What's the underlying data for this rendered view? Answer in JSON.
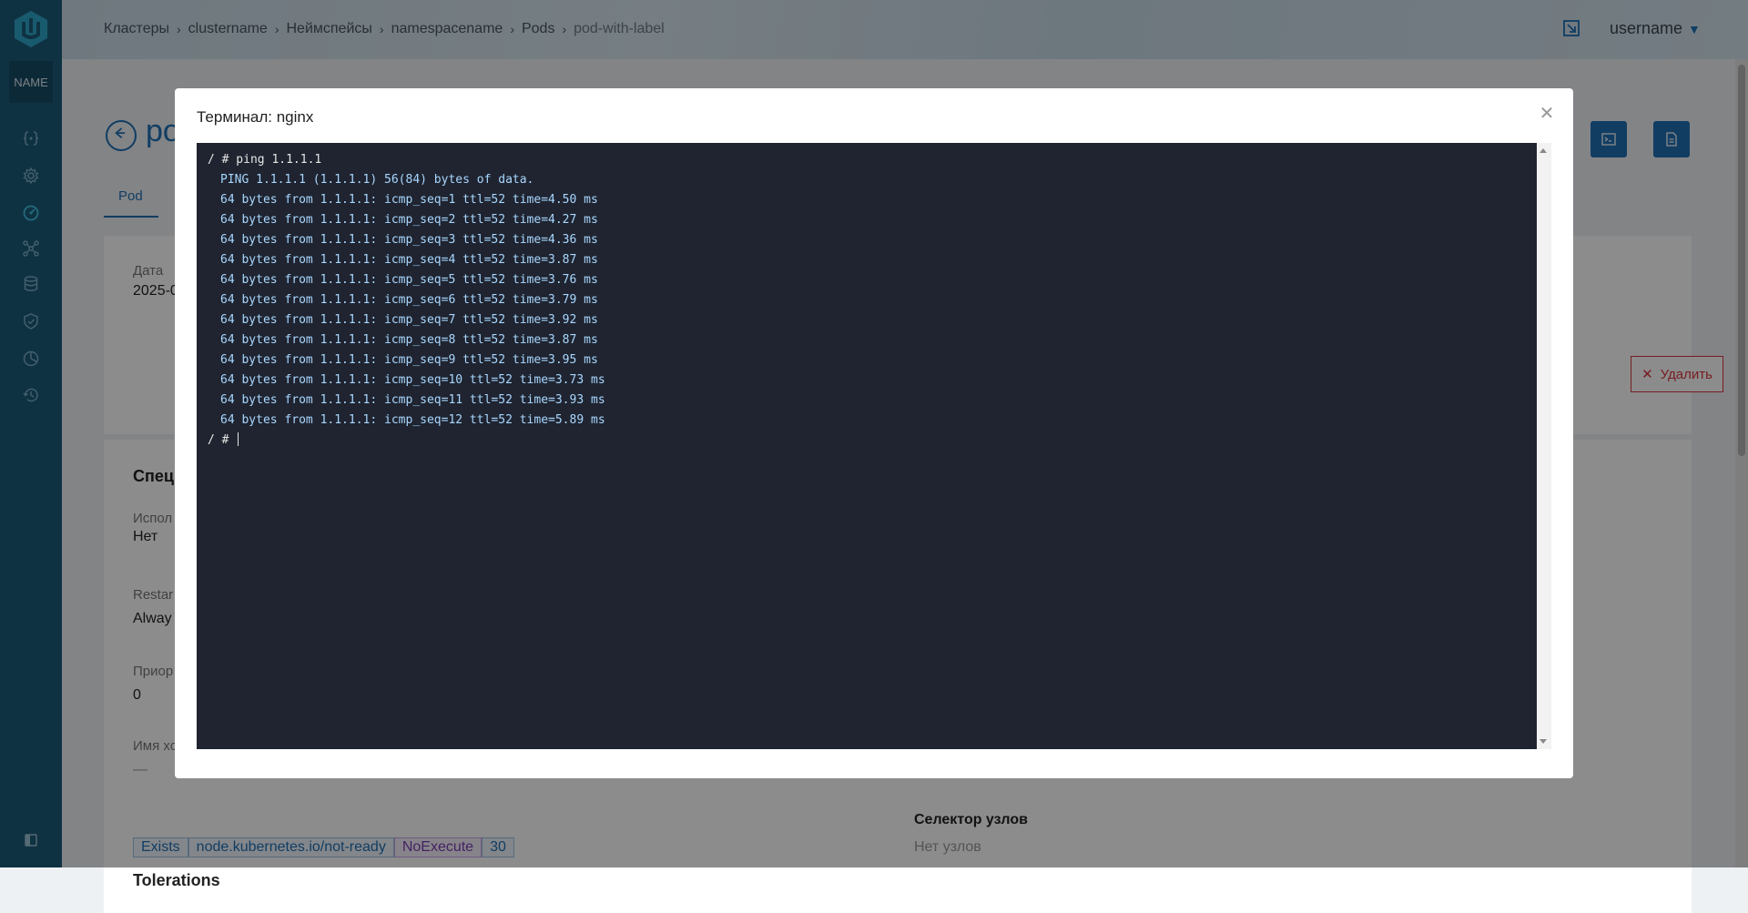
{
  "sidebar": {
    "name_box": "NAME",
    "icons": [
      "braces-icon",
      "gear-icon",
      "dashboard-icon",
      "network-icon",
      "database-icon",
      "shield-icon",
      "pie-chart-icon",
      "history-icon"
    ]
  },
  "header": {
    "breadcrumb": [
      "Кластеры",
      "clustername",
      "Неймспейсы",
      "namespacename",
      "Pods",
      "pod-with-label"
    ],
    "username": "username"
  },
  "background": {
    "title": "po",
    "tab_pod": "Pod",
    "label_date": "Дата",
    "value_date": "2025-0",
    "delete_label": "Удалить",
    "spec_heading": "Спец",
    "label_used": "Испол",
    "value_used": "Нет",
    "label_restart": "Restar",
    "value_restart": "Alway",
    "label_priority": "Приор",
    "value_priority": "0",
    "label_hostname": "Имя хо",
    "value_hostname": "—",
    "tolerations_heading": "Tolerations",
    "tolerations": [
      "Exists",
      "node.kubernetes.io/not-ready",
      "NoExecute",
      "30"
    ],
    "node_selector_heading": "Селектор узлов",
    "node_selector_value": "Нет узлов"
  },
  "modal": {
    "title": "Терминал: nginx",
    "terminal_lines": [
      {
        "kind": "prompt",
        "text": "/ # ping 1.1.1.1"
      },
      {
        "kind": "out",
        "text": "PING 1.1.1.1 (1.1.1.1) 56(84) bytes of data."
      },
      {
        "kind": "out",
        "text": "64 bytes from 1.1.1.1: icmp_seq=1 ttl=52 time=4.50 ms"
      },
      {
        "kind": "out",
        "text": "64 bytes from 1.1.1.1: icmp_seq=2 ttl=52 time=4.27 ms"
      },
      {
        "kind": "out",
        "text": "64 bytes from 1.1.1.1: icmp_seq=3 ttl=52 time=4.36 ms"
      },
      {
        "kind": "out",
        "text": "64 bytes from 1.1.1.1: icmp_seq=4 ttl=52 time=3.87 ms"
      },
      {
        "kind": "out",
        "text": "64 bytes from 1.1.1.1: icmp_seq=5 ttl=52 time=3.76 ms"
      },
      {
        "kind": "out",
        "text": "64 bytes from 1.1.1.1: icmp_seq=6 ttl=52 time=3.79 ms"
      },
      {
        "kind": "out",
        "text": "64 bytes from 1.1.1.1: icmp_seq=7 ttl=52 time=3.92 ms"
      },
      {
        "kind": "out",
        "text": "64 bytes from 1.1.1.1: icmp_seq=8 ttl=52 time=3.87 ms"
      },
      {
        "kind": "out",
        "text": "64 bytes from 1.1.1.1: icmp_seq=9 ttl=52 time=3.95 ms"
      },
      {
        "kind": "out",
        "text": "64 bytes from 1.1.1.1: icmp_seq=10 ttl=52 time=3.73 ms"
      },
      {
        "kind": "out",
        "text": "64 bytes from 1.1.1.1: icmp_seq=11 ttl=52 time=3.93 ms"
      },
      {
        "kind": "out",
        "text": "64 bytes from 1.1.1.1: icmp_seq=12 ttl=52 time=5.89 ms"
      },
      {
        "kind": "prompt",
        "text": "/ # "
      }
    ]
  },
  "colors": {
    "sidebar": "#1d5c7a",
    "accent": "#1f6fb5",
    "danger": "#d9363e",
    "terminal_bg": "#1f2430",
    "terminal_text": "#a9d7ff"
  }
}
